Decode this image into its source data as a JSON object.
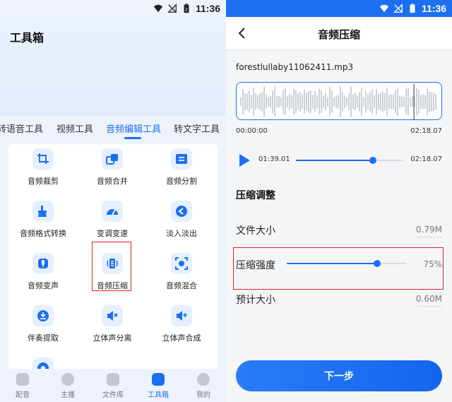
{
  "status_bar": {
    "time": "11:36"
  },
  "left": {
    "title": "工具箱",
    "tabs": [
      {
        "label": "转语音工具",
        "active": false
      },
      {
        "label": "视频工具",
        "active": false
      },
      {
        "label": "音频编辑工具",
        "active": true
      },
      {
        "label": "转文字工具",
        "active": false
      }
    ],
    "tools": [
      {
        "label": "音频裁剪",
        "icon": "crop-icon"
      },
      {
        "label": "音频合并",
        "icon": "merge-icon"
      },
      {
        "label": "音频分割",
        "icon": "split-icon"
      },
      {
        "label": "音频格式转换",
        "icon": "format-convert-icon"
      },
      {
        "label": "变调变速",
        "icon": "speedometer-icon"
      },
      {
        "label": "淡入淡出",
        "icon": "fade-icon"
      },
      {
        "label": "音频变声",
        "icon": "microphone-icon"
      },
      {
        "label": "音频压缩",
        "icon": "compress-icon"
      },
      {
        "label": "音频混合",
        "icon": "mix-icon"
      },
      {
        "label": "伴奏提取",
        "icon": "extract-icon"
      },
      {
        "label": "立体声分离",
        "icon": "speaker-split-icon"
      },
      {
        "label": "立体声合成",
        "icon": "speaker-merge-icon"
      }
    ],
    "bottom_nav": [
      {
        "label": "配音",
        "icon": "dub-icon",
        "active": false
      },
      {
        "label": "主播",
        "icon": "anchor-face-icon",
        "active": false
      },
      {
        "label": "文件库",
        "icon": "file-library-icon",
        "active": false
      },
      {
        "label": "工具箱",
        "icon": "toolbox-icon",
        "active": true
      },
      {
        "label": "我的",
        "icon": "profile-icon",
        "active": false
      }
    ],
    "accent_color": "#1b6ff0",
    "highlight_color": "#e02020"
  },
  "right": {
    "title": "音频压缩",
    "file_name": "forestlullaby11062411.mp3",
    "waveform_start": "00:00:00",
    "waveform_end": "02:18.07",
    "player": {
      "current": "01:39.01",
      "total": "02:18.07",
      "progress": 0.72
    },
    "section_title": "压缩调整",
    "file_size": {
      "label": "文件大小",
      "value": "0.79M"
    },
    "strength": {
      "label": "压缩强度",
      "value": "75%",
      "level": 0.75
    },
    "estimated_size": {
      "label": "预计大小",
      "value": "0.60M"
    },
    "next_button": "下一步",
    "primary_color": "#1d6ff2"
  }
}
